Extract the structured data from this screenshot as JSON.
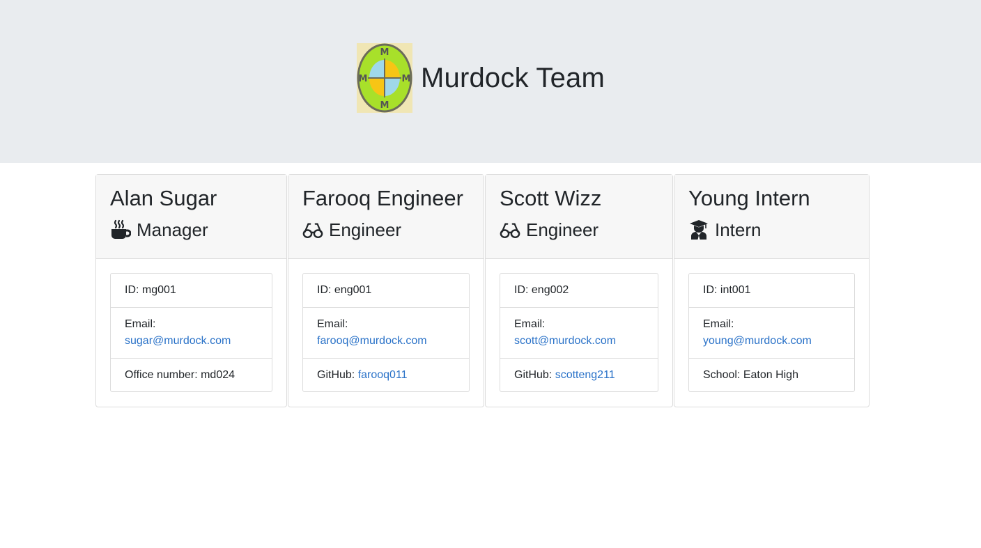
{
  "header": {
    "logo_letter": "M",
    "title": "Murdock Team"
  },
  "colors": {
    "jumbotron_bg": "#e9ecef",
    "link": "#2a72c8",
    "logo_bg": "#f0e6b4",
    "logo_ring": "#a8e02a",
    "logo_quadrant_blue": "#9fd8ea",
    "logo_quadrant_yellow": "#f7c515"
  },
  "employees": [
    {
      "name": "Alan Sugar",
      "role": "Manager",
      "role_icon": "mug-hot-icon",
      "id_text": "ID: mg001",
      "email_label": "Email:",
      "email": "sugar@murdock.com",
      "extra_label": "Office number: md024",
      "extra_link": ""
    },
    {
      "name": "Farooq Engineer",
      "role": "Engineer",
      "role_icon": "glasses-icon",
      "id_text": "ID: eng001",
      "email_label": "Email:",
      "email": "farooq@murdock.com",
      "extra_label": "GitHub: ",
      "extra_link": "farooq011"
    },
    {
      "name": "Scott Wizz",
      "role": "Engineer",
      "role_icon": "glasses-icon",
      "id_text": "ID: eng002",
      "email_label": "Email:",
      "email": "scott@murdock.com",
      "extra_label": "GitHub: ",
      "extra_link": "scotteng211"
    },
    {
      "name": "Young Intern",
      "role": "Intern",
      "role_icon": "graduate-icon",
      "id_text": "ID: int001",
      "email_label": "Email:",
      "email": "young@murdock.com",
      "extra_label": "School: Eaton High",
      "extra_link": ""
    }
  ]
}
